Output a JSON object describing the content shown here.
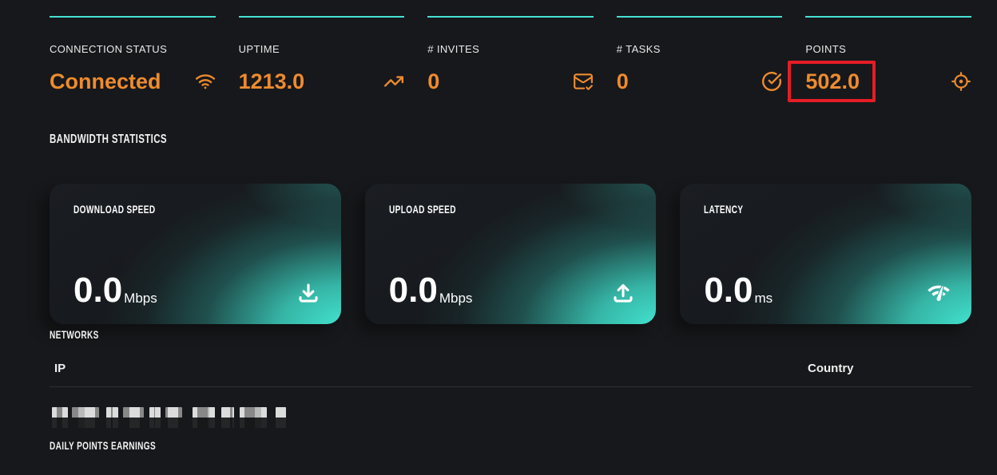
{
  "colors": {
    "bg": "#17181b",
    "orange": "#ee8b2e",
    "teal": "#47e0d4",
    "red": "#e51d26"
  },
  "stats": [
    {
      "label": "CONNECTION STATUS",
      "value": "Connected",
      "icon": "wifi-icon",
      "highlighted": false
    },
    {
      "label": "UPTIME",
      "value": "1213.0",
      "icon": "trending-up-icon",
      "highlighted": false
    },
    {
      "label": "# INVITES",
      "value": "0",
      "icon": "mail-check-icon",
      "highlighted": false
    },
    {
      "label": "# TASKS",
      "value": "0",
      "icon": "check-circle-icon",
      "highlighted": false
    },
    {
      "label": "POINTS",
      "value": "502.0",
      "icon": "crosshair-icon",
      "highlighted": true
    }
  ],
  "section_headings": {
    "bandwidth": "BANDWIDTH STATISTICS",
    "networks": "NETWORKS",
    "daily_points": "DAILY POINTS EARNINGS"
  },
  "bandwidth_cards": [
    {
      "label": "DOWNLOAD SPEED",
      "value": "0.0",
      "unit": "Mbps",
      "icon": "download-icon"
    },
    {
      "label": "UPLOAD SPEED",
      "value": "0.0",
      "unit": "Mbps",
      "icon": "upload-icon"
    },
    {
      "label": "LATENCY",
      "value": "0.0",
      "unit": "ms",
      "icon": "network-gauge-icon"
    }
  ],
  "networks_table": {
    "columns": {
      "ip": "IP",
      "country": "Country"
    },
    "rows": [
      {
        "ip_redacted": true,
        "country": ""
      }
    ]
  }
}
